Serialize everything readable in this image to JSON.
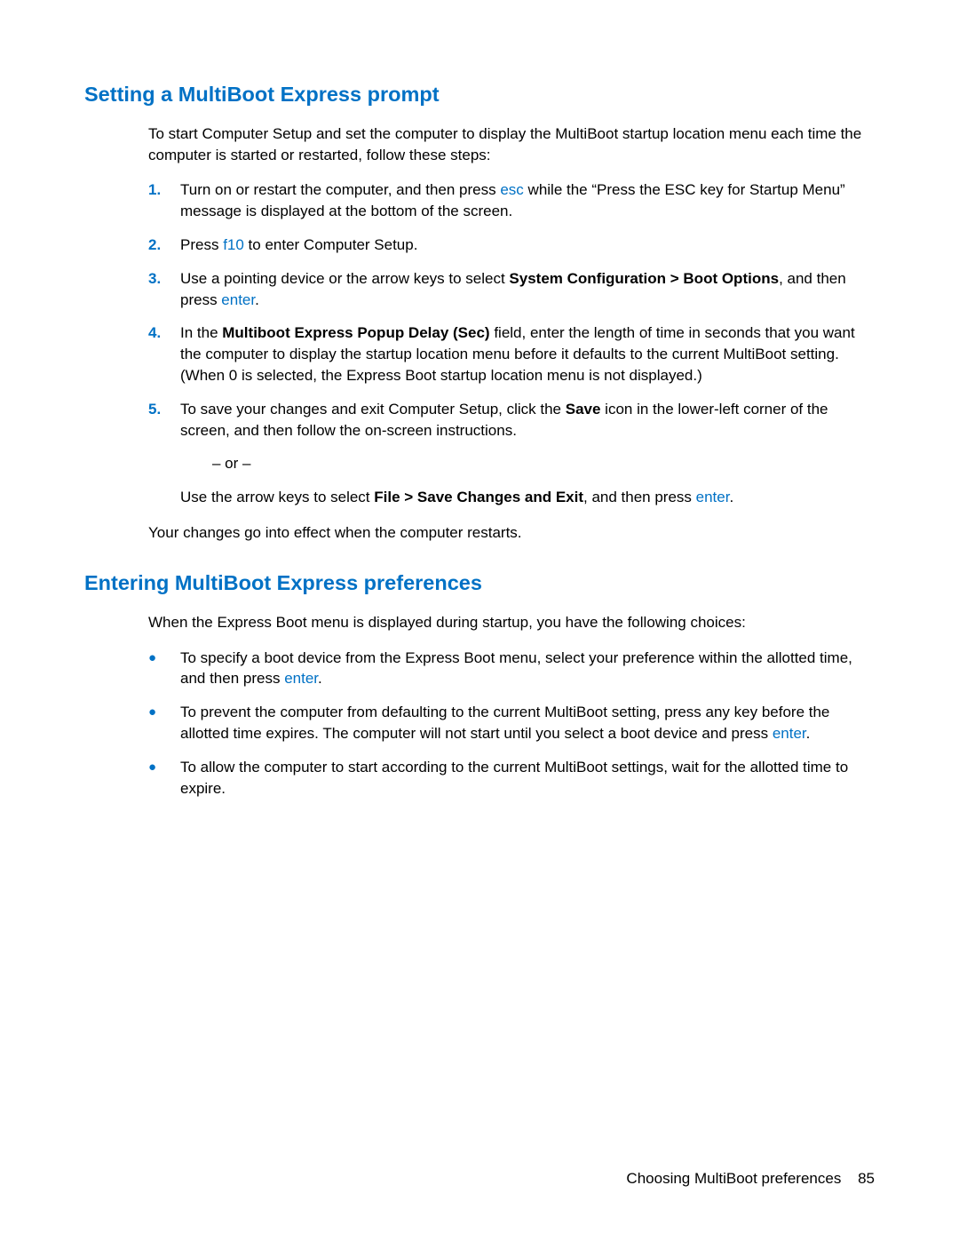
{
  "section1": {
    "heading": "Setting a MultiBoot Express prompt",
    "intro": "To start Computer Setup and set the computer to display the MultiBoot startup location menu each time the computer is started or restarted, follow these steps:",
    "steps": {
      "1": {
        "num": "1.",
        "pre": "Turn on or restart the computer, and then press ",
        "key": "esc",
        "post": " while the “Press the ESC key for Startup Menu” message is displayed at the bottom of the screen."
      },
      "2": {
        "num": "2.",
        "pre": "Press ",
        "key": "f10",
        "post": " to enter Computer Setup."
      },
      "3": {
        "num": "3.",
        "pre": "Use a pointing device or the arrow keys to select ",
        "bold": "System Configuration > Boot Options",
        "mid": ", and then press ",
        "key": "enter",
        "post": "."
      },
      "4": {
        "num": "4.",
        "pre": "In the ",
        "bold": "Multiboot Express Popup Delay (Sec)",
        "post": " field, enter the length of time in seconds that you want the computer to display the startup location menu before it defaults to the current MultiBoot setting. (When 0 is selected, the Express Boot startup location menu is not displayed.)"
      },
      "5": {
        "num": "5.",
        "pre": "To save your changes and exit Computer Setup, click the ",
        "bold": "Save",
        "post": " icon in the lower-left corner of the screen, and then follow the on-screen instructions.",
        "or": "– or –",
        "alt_pre": "Use the arrow keys to select ",
        "alt_bold": "File > Save Changes and Exit",
        "alt_mid": ", and then press ",
        "alt_key": "enter",
        "alt_post": "."
      }
    },
    "closing": "Your changes go into effect when the computer restarts."
  },
  "section2": {
    "heading": "Entering MultiBoot Express preferences",
    "intro": "When the Express Boot menu is displayed during startup, you have the following choices:",
    "bullets": {
      "1": {
        "pre": "To specify a boot device from the Express Boot menu, select your preference within the allotted time, and then press ",
        "key": "enter",
        "post": "."
      },
      "2": {
        "pre": "To prevent the computer from defaulting to the current MultiBoot setting, press any key before the allotted time expires. The computer will not start until you select a boot device and press ",
        "key": "enter",
        "post": "."
      },
      "3": {
        "text": "To allow the computer to start according to the current MultiBoot settings, wait for the allotted time to expire."
      }
    }
  },
  "footer": {
    "text": "Choosing MultiBoot preferences",
    "page": "85"
  },
  "bullet_char": "●"
}
